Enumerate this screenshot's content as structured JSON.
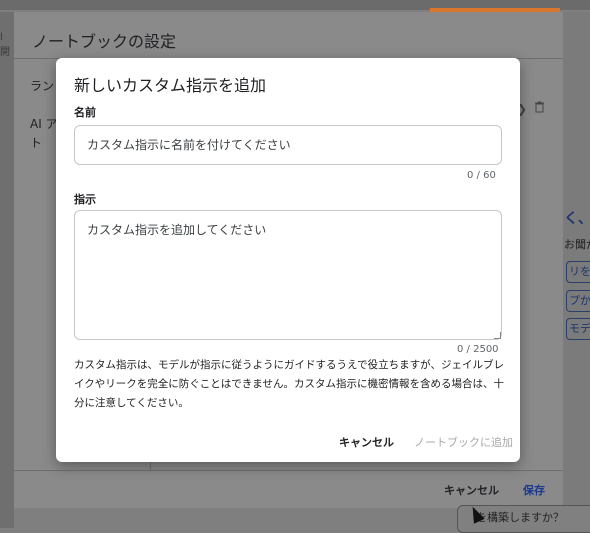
{
  "background": {
    "left_fragment": "l 開",
    "right_items": [
      "リを",
      "プから",
      "モデル"
    ],
    "right_fragments": [
      "く、",
      "お聞か"
    ],
    "bottom_input_text": "を構築しますか？"
  },
  "settings_dialog": {
    "title": "ノートブックの設定",
    "nav": [
      "ラン",
      "AI ア",
      "ト"
    ],
    "cancel_label": "キャンセル",
    "save_label": "保存"
  },
  "dialog": {
    "title": "新しいカスタム指示を追加",
    "name_label": "名前",
    "name_placeholder": "カスタム指示に名前を付けてください",
    "name_value": "",
    "name_counter": "0 / 60",
    "instruction_label": "指示",
    "instruction_placeholder": "カスタム指示を追加してください",
    "instruction_value": "",
    "instruction_counter": "0 / 2500",
    "help_text": "カスタム指示は、モデルが指示に従うようにガイドするうえで役立ちますが、ジェイルブレイクやリークを完全に防ぐことはできません。カスタム指示に機密情報を含める場合は、十分に注意してください。",
    "cancel_label": "キャンセル",
    "add_label": "ノートブックに追加",
    "add_enabled": false
  },
  "colors": {
    "accent": "#1a3a8f",
    "disabled": "#a8a8a8",
    "orange_bar": "#d9762b"
  }
}
